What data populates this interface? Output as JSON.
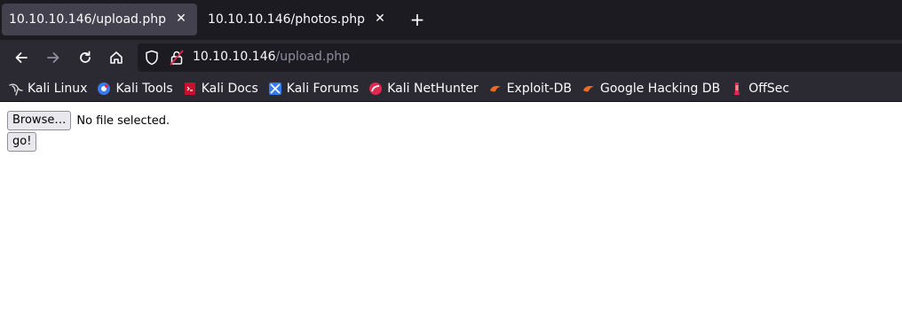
{
  "tabs": [
    {
      "title": "10.10.10.146/upload.php",
      "active": true
    },
    {
      "title": "10.10.10.146/photos.php",
      "active": false
    }
  ],
  "urlbar": {
    "host": "10.10.10.146",
    "path": "/upload.php"
  },
  "bookmarks": [
    {
      "label": "Kali Linux",
      "icon": "kali-dragon-icon"
    },
    {
      "label": "Kali Tools",
      "icon": "kali-tools-icon"
    },
    {
      "label": "Kali Docs",
      "icon": "kali-docs-icon"
    },
    {
      "label": "Kali Forums",
      "icon": "kali-forums-icon"
    },
    {
      "label": "Kali NetHunter",
      "icon": "nethunter-icon"
    },
    {
      "label": "Exploit-DB",
      "icon": "exploit-db-icon"
    },
    {
      "label": "Google Hacking DB",
      "icon": "ghdb-icon"
    },
    {
      "label": "OffSec",
      "icon": "offsec-icon"
    }
  ],
  "page": {
    "browse_label": "Browse…",
    "file_status": "No file selected.",
    "go_label": "go!"
  },
  "colors": {
    "tabstrip": "#1c1b22",
    "navbar": "#2b2a33",
    "active_tab": "#42414d"
  }
}
